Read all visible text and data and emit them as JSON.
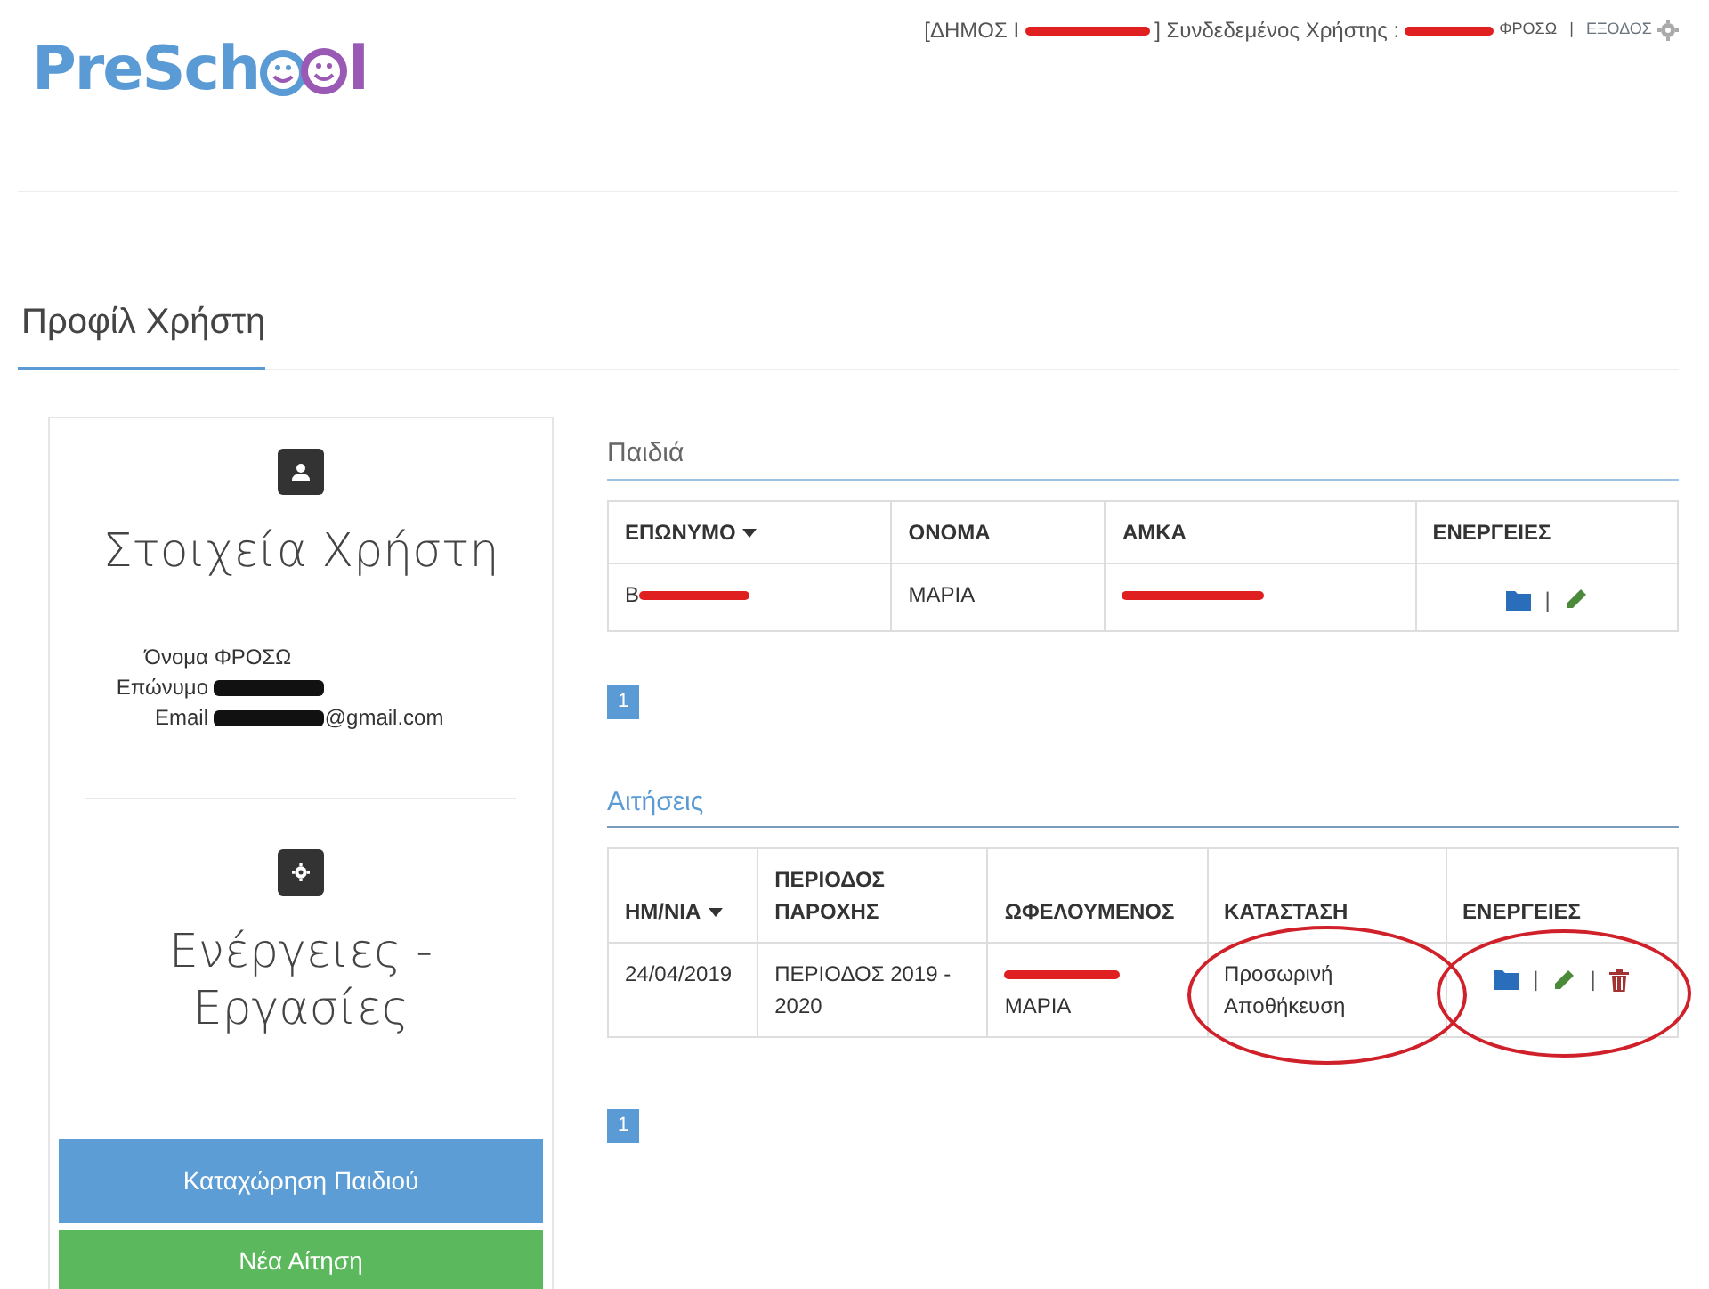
{
  "logo": {
    "before": "PreSch",
    "after": "l"
  },
  "header": {
    "municipality_prefix": "[ΔΗΜΟΣ Ι",
    "user_label": "] Συνδεδεμένος Χρήστης :",
    "user_name": "ΦΡΟΣΩ",
    "separator": "|",
    "logout": "ΕΞΟΔΟΣ"
  },
  "page_title": "Προφίλ Χρήστη",
  "profile": {
    "title": "Στοιχεία Χρήστη",
    "fields": [
      {
        "label": "Όνομα",
        "value": "ΦΡΟΣΩ",
        "redacted": false
      },
      {
        "label": "Επώνυμο",
        "redacted": true
      },
      {
        "label": "Email",
        "value": "@gmail.com",
        "redacted": true
      }
    ]
  },
  "actions_panel": {
    "title": "Ενέργειες - Εργασίες",
    "buttons": [
      {
        "label": "Καταχώρηση Παιδιού",
        "kind": "primary"
      },
      {
        "label": "Νέα Αίτηση",
        "kind": "success"
      }
    ]
  },
  "children": {
    "title": "Παιδιά",
    "columns": [
      {
        "label": "ΕΠΩΝΥΜΟ",
        "sorted": true
      },
      {
        "label": "ΟΝΟΜΑ",
        "sorted": false
      },
      {
        "label": "ΑΜΚΑ",
        "sorted": false
      },
      {
        "label": "ΕΝΕΡΓΕΙΕΣ",
        "sorted": false
      }
    ],
    "rows": [
      {
        "cells": [
          {
            "text": "Β",
            "redacted": true,
            "circled": false
          },
          {
            "text": "ΜΑΡΙΑ",
            "redacted": false,
            "circled": false
          },
          {
            "redacted": true,
            "circled": false
          }
        ],
        "actions": [
          {
            "kind": "folder"
          },
          {
            "kind": "edit"
          }
        ],
        "actions_circled": false
      }
    ],
    "separator": "|",
    "pages": [
      {
        "label": "1",
        "selected": true
      }
    ]
  },
  "applications": {
    "title": "Αιτήσεις",
    "columns": [
      {
        "label": "ΗΜ/ΝΙΑ",
        "sorted": true
      },
      {
        "label": "ΠΕΡΙΟΔΟΣ ΠΑΡΟΧΗΣ",
        "sorted": false
      },
      {
        "label": "ΩΦΕΛΟΥΜΕΝΟΣ",
        "sorted": false
      },
      {
        "label": "ΚΑΤΑΣΤΑΣΗ",
        "sorted": false
      },
      {
        "label": "ΕΝΕΡΓΕΙΕΣ",
        "sorted": false
      }
    ],
    "rows": [
      {
        "cells": [
          {
            "text": "24/04/2019",
            "redacted": false,
            "circled": false
          },
          {
            "text": "ΠΕΡΙΟΔΟΣ 2019 - 2020",
            "redacted": false,
            "circled": false
          },
          {
            "text": "ΜΑΡΙΑ",
            "redacted": true,
            "circled": false
          },
          {
            "text": "Προσωρινή Αποθήκευση",
            "redacted": false,
            "circled": true
          }
        ],
        "actions": [
          {
            "kind": "folder"
          },
          {
            "kind": "edit"
          },
          {
            "kind": "delete"
          }
        ],
        "actions_circled": true
      }
    ],
    "separator": "|",
    "pages": [
      {
        "label": "1",
        "selected": true
      }
    ]
  }
}
